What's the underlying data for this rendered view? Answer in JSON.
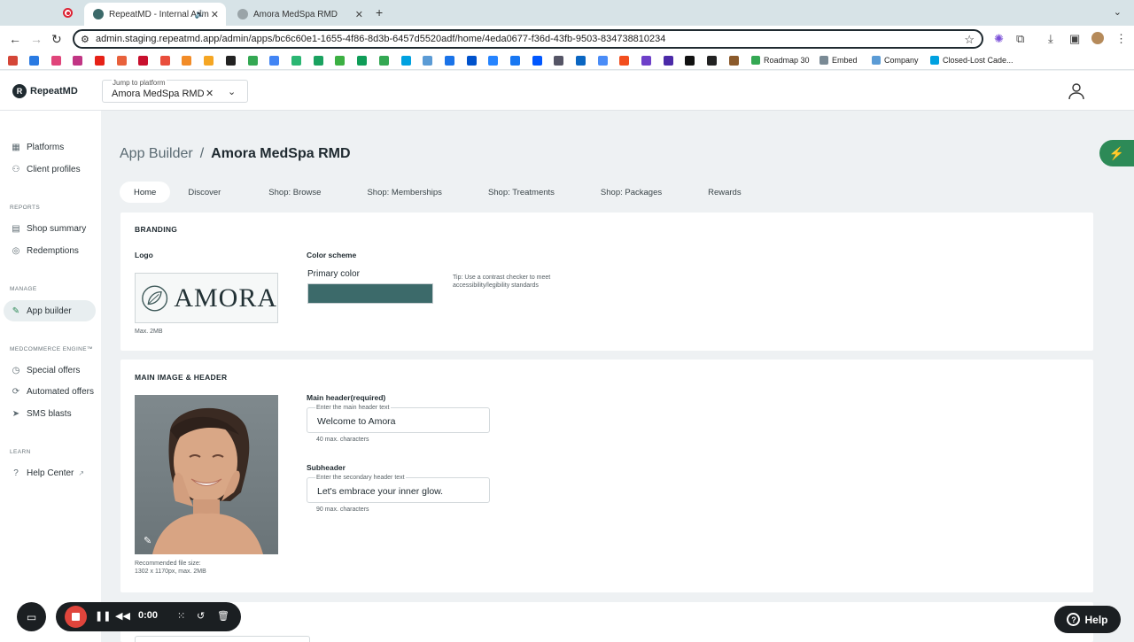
{
  "browser": {
    "tabs": [
      {
        "title": "RepeatMD - Internal Adm",
        "active": true
      },
      {
        "title": "Amora MedSpa RMD",
        "active": false
      }
    ],
    "url": "admin.staging.repeatmd.app/admin/apps/bc6c60e1-1655-4f86-8d3b-6457d5520adf/home/4eda0677-f36d-43fb-9503-834738810234",
    "bookmarks": [
      "Roadmap 30",
      "Embed",
      "Company",
      "Closed-Lost Cade..."
    ]
  },
  "header": {
    "logo_text": "RepeatMD",
    "jump_label": "Jump to platform",
    "jump_value": "Amora MedSpa RMD"
  },
  "sidebar": {
    "platforms": "Platforms",
    "client_profiles": "Client profiles",
    "reports_head": "REPORTS",
    "shop_summary": "Shop summary",
    "redemptions": "Redemptions",
    "manage_head": "MANAGE",
    "app_builder": "App builder",
    "engine_head": "MEDCOMMERCE ENGINE™",
    "special_offers": "Special offers",
    "automated_offers": "Automated offers",
    "sms_blasts": "SMS blasts",
    "learn_head": "LEARN",
    "help_center": "Help Center"
  },
  "breadcrumb": {
    "root": "App Builder",
    "sep": "/",
    "current": "Amora MedSpa RMD"
  },
  "tabs": [
    "Home",
    "Discover",
    "Shop: Browse",
    "Shop: Memberships",
    "Shop: Treatments",
    "Shop: Packages",
    "Rewards"
  ],
  "branding": {
    "title": "BRANDING",
    "logo_label": "Logo",
    "logo_word": "AMORA",
    "logo_hint": "Max. 2MB",
    "color_scheme": "Color scheme",
    "primary_color": "Primary color",
    "tip": "Tip: Use a contrast checker to meet accessibility/legibility standards"
  },
  "main_image": {
    "title": "MAIN IMAGE & HEADER",
    "file_hint_1": "Recommended file size:",
    "file_hint_2": "1302 x 1170px, max. 2MB",
    "main_header_label": "Main header(required)",
    "main_header_float": "Enter the main header text",
    "main_header_value": "Welcome to Amora",
    "main_header_limit": "40 max. characters",
    "subheader_label": "Subheader",
    "subheader_float": "Enter the secondary header text",
    "subheader_value": "Let's embrace your inner glow.",
    "subheader_limit": "90 max. characters"
  },
  "recorder": {
    "time": "0:00"
  },
  "help": {
    "label": "Help"
  },
  "colors": {
    "primary": "#3c6a6a",
    "flash": "#2d8a57"
  }
}
